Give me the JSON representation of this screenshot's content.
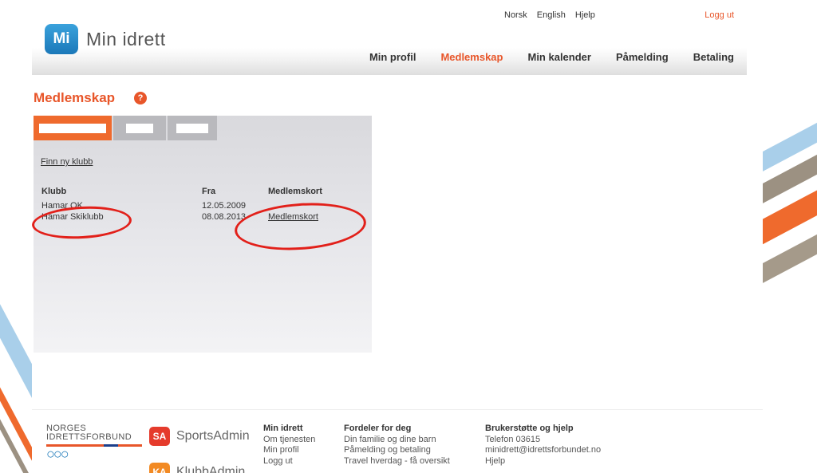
{
  "header": {
    "top_links": [
      "Norsk",
      "English",
      "Hjelp"
    ],
    "logout": "Logg ut",
    "logo_badge": "Mi",
    "logo_text": "Min idrett",
    "nav": [
      "Min profil",
      "Medlemskap",
      "Min kalender",
      "Påmelding",
      "Betaling"
    ],
    "nav_active": "Medlemskap"
  },
  "main": {
    "title": "Medlemskap",
    "help_icon": "?",
    "find_link": "Finn ny klubb",
    "table": {
      "headers": [
        "Klubb",
        "Fra",
        "Medlemskort"
      ],
      "rows": [
        {
          "klubb": "Hamar OK",
          "fra": "12.05.2009",
          "kort": ""
        },
        {
          "klubb": "Hamar Skiklubb",
          "fra": "08.08.2013",
          "kort": "Medlemskort"
        }
      ]
    }
  },
  "footer": {
    "nif_line1": "NORGES",
    "nif_line2": "IDRETTSFORBUND",
    "sportsadmin": "SportsAdmin",
    "sa_badge": "SA",
    "klubbadmin": "KlubbAdmin",
    "ka_badge": "KA",
    "col_a": {
      "heading": "Min idrett",
      "items": [
        "Om tjenesten",
        "Min profil",
        "Logg ut"
      ]
    },
    "col_b": {
      "heading": "Fordeler for deg",
      "items": [
        "Din familie og dine barn",
        "Påmelding og betaling",
        "Travel hverdag - få oversikt"
      ]
    },
    "col_c": {
      "heading": "Brukerstøtte og hjelp",
      "items": [
        "Telefon 03615",
        "minidrett@idrettsforbundet.no",
        "Hjelp"
      ]
    }
  },
  "colors": {
    "accent": "#e8562a",
    "logo_blue": "#1b78b9",
    "annotation_red": "#e2201a"
  }
}
